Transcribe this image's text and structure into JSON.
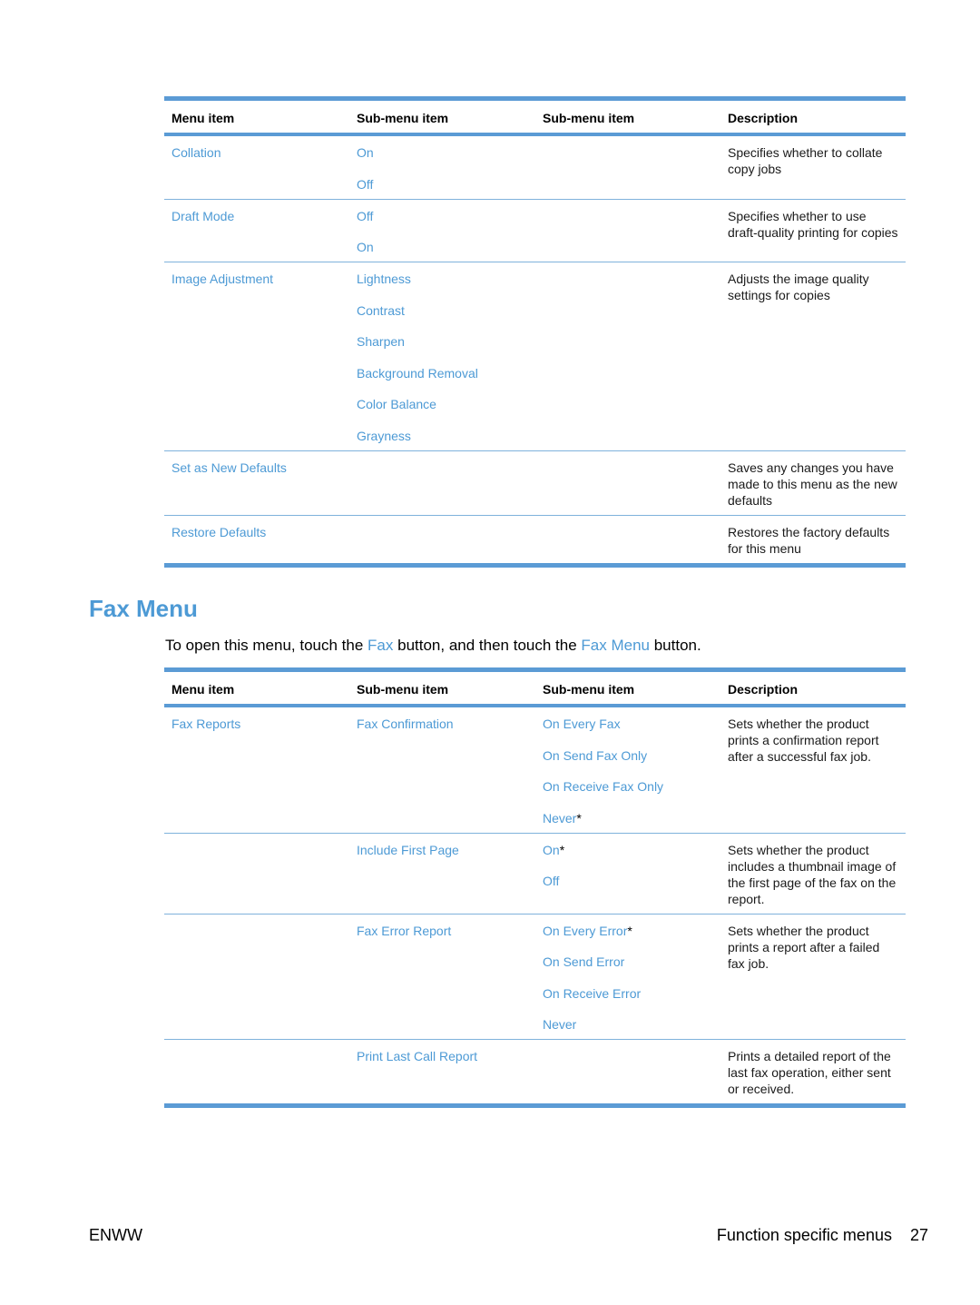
{
  "copy_table": {
    "headers": [
      "Menu item",
      "Sub-menu item",
      "Sub-menu item",
      "Description"
    ],
    "rows": [
      {
        "menu_item": "Collation",
        "sub1": [
          "On",
          "Off"
        ],
        "sub2": [],
        "description": "Specifies whether to collate copy jobs"
      },
      {
        "menu_item": "Draft Mode",
        "sub1": [
          "Off",
          "On"
        ],
        "sub2": [],
        "description": "Specifies whether to use draft-quality printing for copies"
      },
      {
        "menu_item": "Image Adjustment",
        "sub1": [
          "Lightness",
          "Contrast",
          "Sharpen",
          "Background Removal",
          "Color Balance",
          "Grayness"
        ],
        "sub2": [],
        "description": "Adjusts the image quality settings for copies"
      },
      {
        "menu_item": "Set as New Defaults",
        "sub1": [],
        "sub2": [],
        "description": "Saves any changes you have made to this menu as the new defaults"
      },
      {
        "menu_item": "Restore Defaults",
        "sub1": [],
        "sub2": [],
        "description": "Restores the factory defaults for this menu"
      }
    ]
  },
  "fax_section": {
    "title": "Fax Menu",
    "intro": {
      "part1": "To open this menu, touch the ",
      "link1": "Fax",
      "part2": " button, and then touch the ",
      "link2": "Fax Menu",
      "part3": " button."
    }
  },
  "fax_table": {
    "headers": [
      "Menu item",
      "Sub-menu item",
      "Sub-menu item",
      "Description"
    ],
    "rows": [
      {
        "menu_item": "Fax Reports",
        "sub1": [
          "Fax Confirmation"
        ],
        "sub2": [
          {
            "label": "On Every Fax",
            "default": ""
          },
          {
            "label": "On Send Fax Only",
            "default": ""
          },
          {
            "label": "On Receive Fax Only",
            "default": ""
          },
          {
            "label": "Never",
            "default": "*"
          }
        ],
        "description": "Sets whether the product prints a confirmation report after a successful fax job."
      },
      {
        "menu_item": "",
        "sub1": [
          "Include First Page"
        ],
        "sub2": [
          {
            "label": "On",
            "default": "*"
          },
          {
            "label": "Off",
            "default": ""
          }
        ],
        "description": "Sets whether the product includes a thumbnail image of the first page of the fax on the report."
      },
      {
        "menu_item": "",
        "sub1": [
          "Fax Error Report"
        ],
        "sub2": [
          {
            "label": "On Every Error",
            "default": "*"
          },
          {
            "label": "On Send Error",
            "default": ""
          },
          {
            "label": "On Receive Error",
            "default": ""
          },
          {
            "label": "Never",
            "default": ""
          }
        ],
        "description": "Sets whether the product prints a report after a failed fax job."
      },
      {
        "menu_item": "",
        "sub1": [
          "Print Last Call Report"
        ],
        "sub2": [],
        "description": "Prints a detailed report of the last fax operation, either sent or received."
      }
    ]
  },
  "footer": {
    "left": "ENWW",
    "section": "Function specific menus",
    "page_number": "27"
  }
}
